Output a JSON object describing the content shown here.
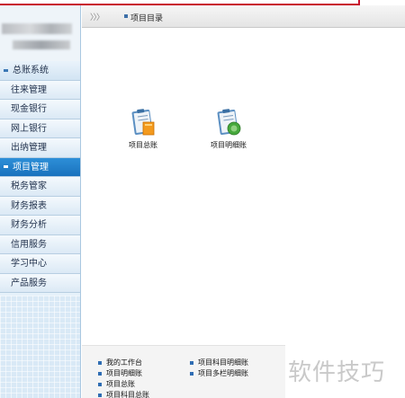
{
  "header": {
    "breadcrumb_arrows": "〉〉〉",
    "title": "项目目录"
  },
  "sidebar": {
    "items": [
      {
        "label": "总账系统",
        "type": "group"
      },
      {
        "label": "往来管理",
        "type": "item"
      },
      {
        "label": "现金银行",
        "type": "item"
      },
      {
        "label": "网上银行",
        "type": "item"
      },
      {
        "label": "出纳管理",
        "type": "item"
      },
      {
        "label": "项目管理",
        "type": "group",
        "active": true
      },
      {
        "label": "税务管家",
        "type": "item"
      },
      {
        "label": "财务报表",
        "type": "item"
      },
      {
        "label": "财务分析",
        "type": "item"
      },
      {
        "label": "信用服务",
        "type": "item"
      },
      {
        "label": "学习中心",
        "type": "item"
      },
      {
        "label": "产品服务",
        "type": "item"
      }
    ]
  },
  "main": {
    "tiles": [
      {
        "label": "项目总账",
        "icon": "ledger-icon"
      },
      {
        "label": "项目明细账",
        "icon": "detail-ledger-icon"
      }
    ]
  },
  "bottom": {
    "links": [
      {
        "label": "我的工作台"
      },
      {
        "label": "项目明细账"
      },
      {
        "label": "项目总账"
      },
      {
        "label": "项目科目总账"
      },
      {
        "label": "项目科目明细账"
      },
      {
        "label": "项目多栏明细账"
      }
    ]
  },
  "watermark": "软件技巧",
  "colors": {
    "accent": "#1a72bd",
    "header_red": "#c8102e",
    "sidebar_bg": "#e6f1fa"
  }
}
